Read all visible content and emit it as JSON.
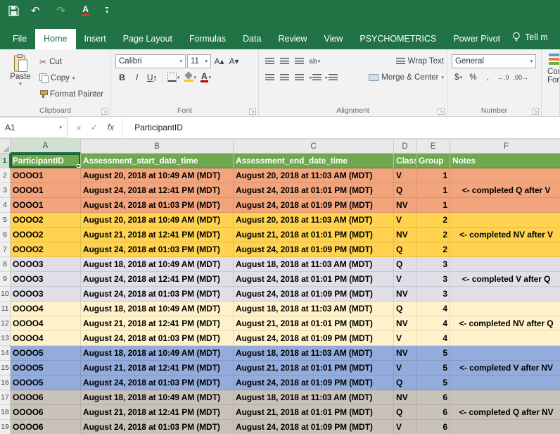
{
  "app": {
    "name": "Excel",
    "accent": "#217346"
  },
  "icons": {
    "dropdown": "▾",
    "undo": "↶",
    "redo": "↷",
    "cancel": "×",
    "enter": "✓",
    "fx": "fx",
    "scissors": "✂",
    "launcher": "↘",
    "font_color_letter": "A",
    "increase_font": "A▴",
    "decrease_font": "A▾",
    "orientation_ab": "ab",
    "wrap_ab": "ab",
    "outdent_arrow": "◂",
    "indent_arrow": "▸",
    "increase_decimal": "←.0",
    "decrease_decimal": ".00→"
  },
  "ribbon": {
    "tabs": [
      {
        "label": "File",
        "active": false
      },
      {
        "label": "Home",
        "active": true
      },
      {
        "label": "Insert",
        "active": false
      },
      {
        "label": "Page Layout",
        "active": false
      },
      {
        "label": "Formulas",
        "active": false
      },
      {
        "label": "Data",
        "active": false
      },
      {
        "label": "Review",
        "active": false
      },
      {
        "label": "View",
        "active": false
      },
      {
        "label": "PSYCHOMETRICS",
        "active": false
      },
      {
        "label": "Power Pivot",
        "active": false
      }
    ],
    "tell_me": "Tell m",
    "clipboard": {
      "label": "Clipboard",
      "paste": "Paste",
      "cut": "Cut",
      "copy": "Copy",
      "format_painter": "Format Painter"
    },
    "font": {
      "label": "Font",
      "family": "Calibri",
      "size": "11",
      "bold": "B",
      "italic": "I",
      "underline": "U"
    },
    "alignment": {
      "label": "Alignment",
      "wrap_text": "Wrap Text",
      "merge_center": "Merge & Center"
    },
    "number": {
      "label": "Number",
      "format": "General",
      "currency": "$",
      "percent": "%",
      "comma": ","
    },
    "styles_partial": {
      "line1": "Con",
      "line2": "Form"
    }
  },
  "formula_bar": {
    "name_box": "A1",
    "formula": "ParticipantID"
  },
  "grid": {
    "columns": [
      "A",
      "B",
      "C",
      "D",
      "E",
      "F"
    ],
    "selected_column": "A",
    "selected_row": "1",
    "selected_cell": "A1",
    "header_row": [
      "ParticipantID",
      "Assessment_start_date_time",
      "Assessment_end_date_time",
      "Class",
      "Group",
      "Notes"
    ],
    "colors": {
      "header": "#6FA84E",
      "orange": "#F2A47C",
      "gold": "#FFD34F",
      "lavender": "#E0DFE7",
      "cream": "#FFF1C9",
      "blue": "#93ACDB",
      "taupe": "#C8C2BA"
    },
    "rows": [
      {
        "n": "2",
        "id": "OOOO1",
        "start": "August 20, 2018 at 10:49 AM (MDT)",
        "end": "August 20, 2018 at 11:03 AM (MDT)",
        "cls": "V",
        "grp": "1",
        "note": "",
        "c": "orange"
      },
      {
        "n": "3",
        "id": "OOOO1",
        "start": "August 24, 2018 at 12:41 PM (MDT)",
        "end": "August 24, 2018 at 01:01 PM (MDT)",
        "cls": "Q",
        "grp": "1",
        "note": "<- completed Q after V",
        "c": "orange"
      },
      {
        "n": "4",
        "id": "OOOO1",
        "start": "August 24, 2018 at 01:03 PM (MDT)",
        "end": "August 24, 2018 at 01:09 PM (MDT)",
        "cls": "NV",
        "grp": "1",
        "note": "",
        "c": "orange"
      },
      {
        "n": "5",
        "id": "OOOO2",
        "start": "August 20, 2018 at 10:49 AM (MDT)",
        "end": "August 20, 2018 at 11:03 AM (MDT)",
        "cls": "V",
        "grp": "2",
        "note": "",
        "c": "gold"
      },
      {
        "n": "6",
        "id": "OOOO2",
        "start": "August 21, 2018 at 12:41 PM (MDT)",
        "end": "August 21, 2018 at 01:01 PM (MDT)",
        "cls": "NV",
        "grp": "2",
        "note": "<- completed NV after V",
        "c": "gold"
      },
      {
        "n": "7",
        "id": "OOOO2",
        "start": "August 24, 2018 at 01:03 PM (MDT)",
        "end": "August 24, 2018 at 01:09 PM (MDT)",
        "cls": "Q",
        "grp": "2",
        "note": "",
        "c": "gold"
      },
      {
        "n": "8",
        "id": "OOOO3",
        "start": "August 18, 2018 at 10:49 AM (MDT)",
        "end": "August 18, 2018 at 11:03 AM (MDT)",
        "cls": "Q",
        "grp": "3",
        "note": "",
        "c": "lavender"
      },
      {
        "n": "9",
        "id": "OOOO3",
        "start": "August 24, 2018 at 12:41 PM (MDT)",
        "end": "August 24, 2018 at 01:01 PM (MDT)",
        "cls": "V",
        "grp": "3",
        "note": "<- completed V after Q",
        "c": "lavender"
      },
      {
        "n": "10",
        "id": "OOOO3",
        "start": "August 24, 2018 at 01:03 PM (MDT)",
        "end": "August 24, 2018 at 01:09 PM (MDT)",
        "cls": "NV",
        "grp": "3",
        "note": "",
        "c": "lavender"
      },
      {
        "n": "11",
        "id": "OOOO4",
        "start": "August 18, 2018 at 10:49 AM (MDT)",
        "end": "August 18, 2018 at 11:03 AM (MDT)",
        "cls": "Q",
        "grp": "4",
        "note": "",
        "c": "cream"
      },
      {
        "n": "12",
        "id": "OOOO4",
        "start": "August 21, 2018 at 12:41 PM (MDT)",
        "end": "August 21, 2018 at 01:01 PM (MDT)",
        "cls": "NV",
        "grp": "4",
        "note": "<- completed NV after Q",
        "c": "cream"
      },
      {
        "n": "13",
        "id": "OOOO4",
        "start": "August 24, 2018 at 01:03 PM (MDT)",
        "end": "August 24, 2018 at 01:09 PM (MDT)",
        "cls": "V",
        "grp": "4",
        "note": "",
        "c": "cream"
      },
      {
        "n": "14",
        "id": "OOOO5",
        "start": "August 18, 2018 at 10:49 AM (MDT)",
        "end": "August 18, 2018 at 11:03 AM (MDT)",
        "cls": "NV",
        "grp": "5",
        "note": "",
        "c": "blue"
      },
      {
        "n": "15",
        "id": "OOOO5",
        "start": "August 21, 2018 at 12:41 PM (MDT)",
        "end": "August 21, 2018 at 01:01 PM (MDT)",
        "cls": "V",
        "grp": "5",
        "note": "<- completed V after NV",
        "c": "blue"
      },
      {
        "n": "16",
        "id": "OOOO5",
        "start": "August 24, 2018 at 01:03 PM (MDT)",
        "end": "August 24, 2018 at 01:09 PM (MDT)",
        "cls": "Q",
        "grp": "5",
        "note": "",
        "c": "blue"
      },
      {
        "n": "17",
        "id": "OOOO6",
        "start": "August 18, 2018 at 10:49 AM (MDT)",
        "end": "August 18, 2018 at 11:03 AM (MDT)",
        "cls": "NV",
        "grp": "6",
        "note": "",
        "c": "taupe"
      },
      {
        "n": "18",
        "id": "OOOO6",
        "start": "August 21, 2018 at 12:41 PM (MDT)",
        "end": "August 21, 2018 at 01:01 PM (MDT)",
        "cls": "Q",
        "grp": "6",
        "note": "<- completed Q after NV",
        "c": "taupe"
      },
      {
        "n": "19",
        "id": "OOOO6",
        "start": "August 24, 2018 at 01:03 PM (MDT)",
        "end": "August 24, 2018 at 01:09 PM (MDT)",
        "cls": "V",
        "grp": "6",
        "note": "",
        "c": "taupe"
      }
    ]
  }
}
